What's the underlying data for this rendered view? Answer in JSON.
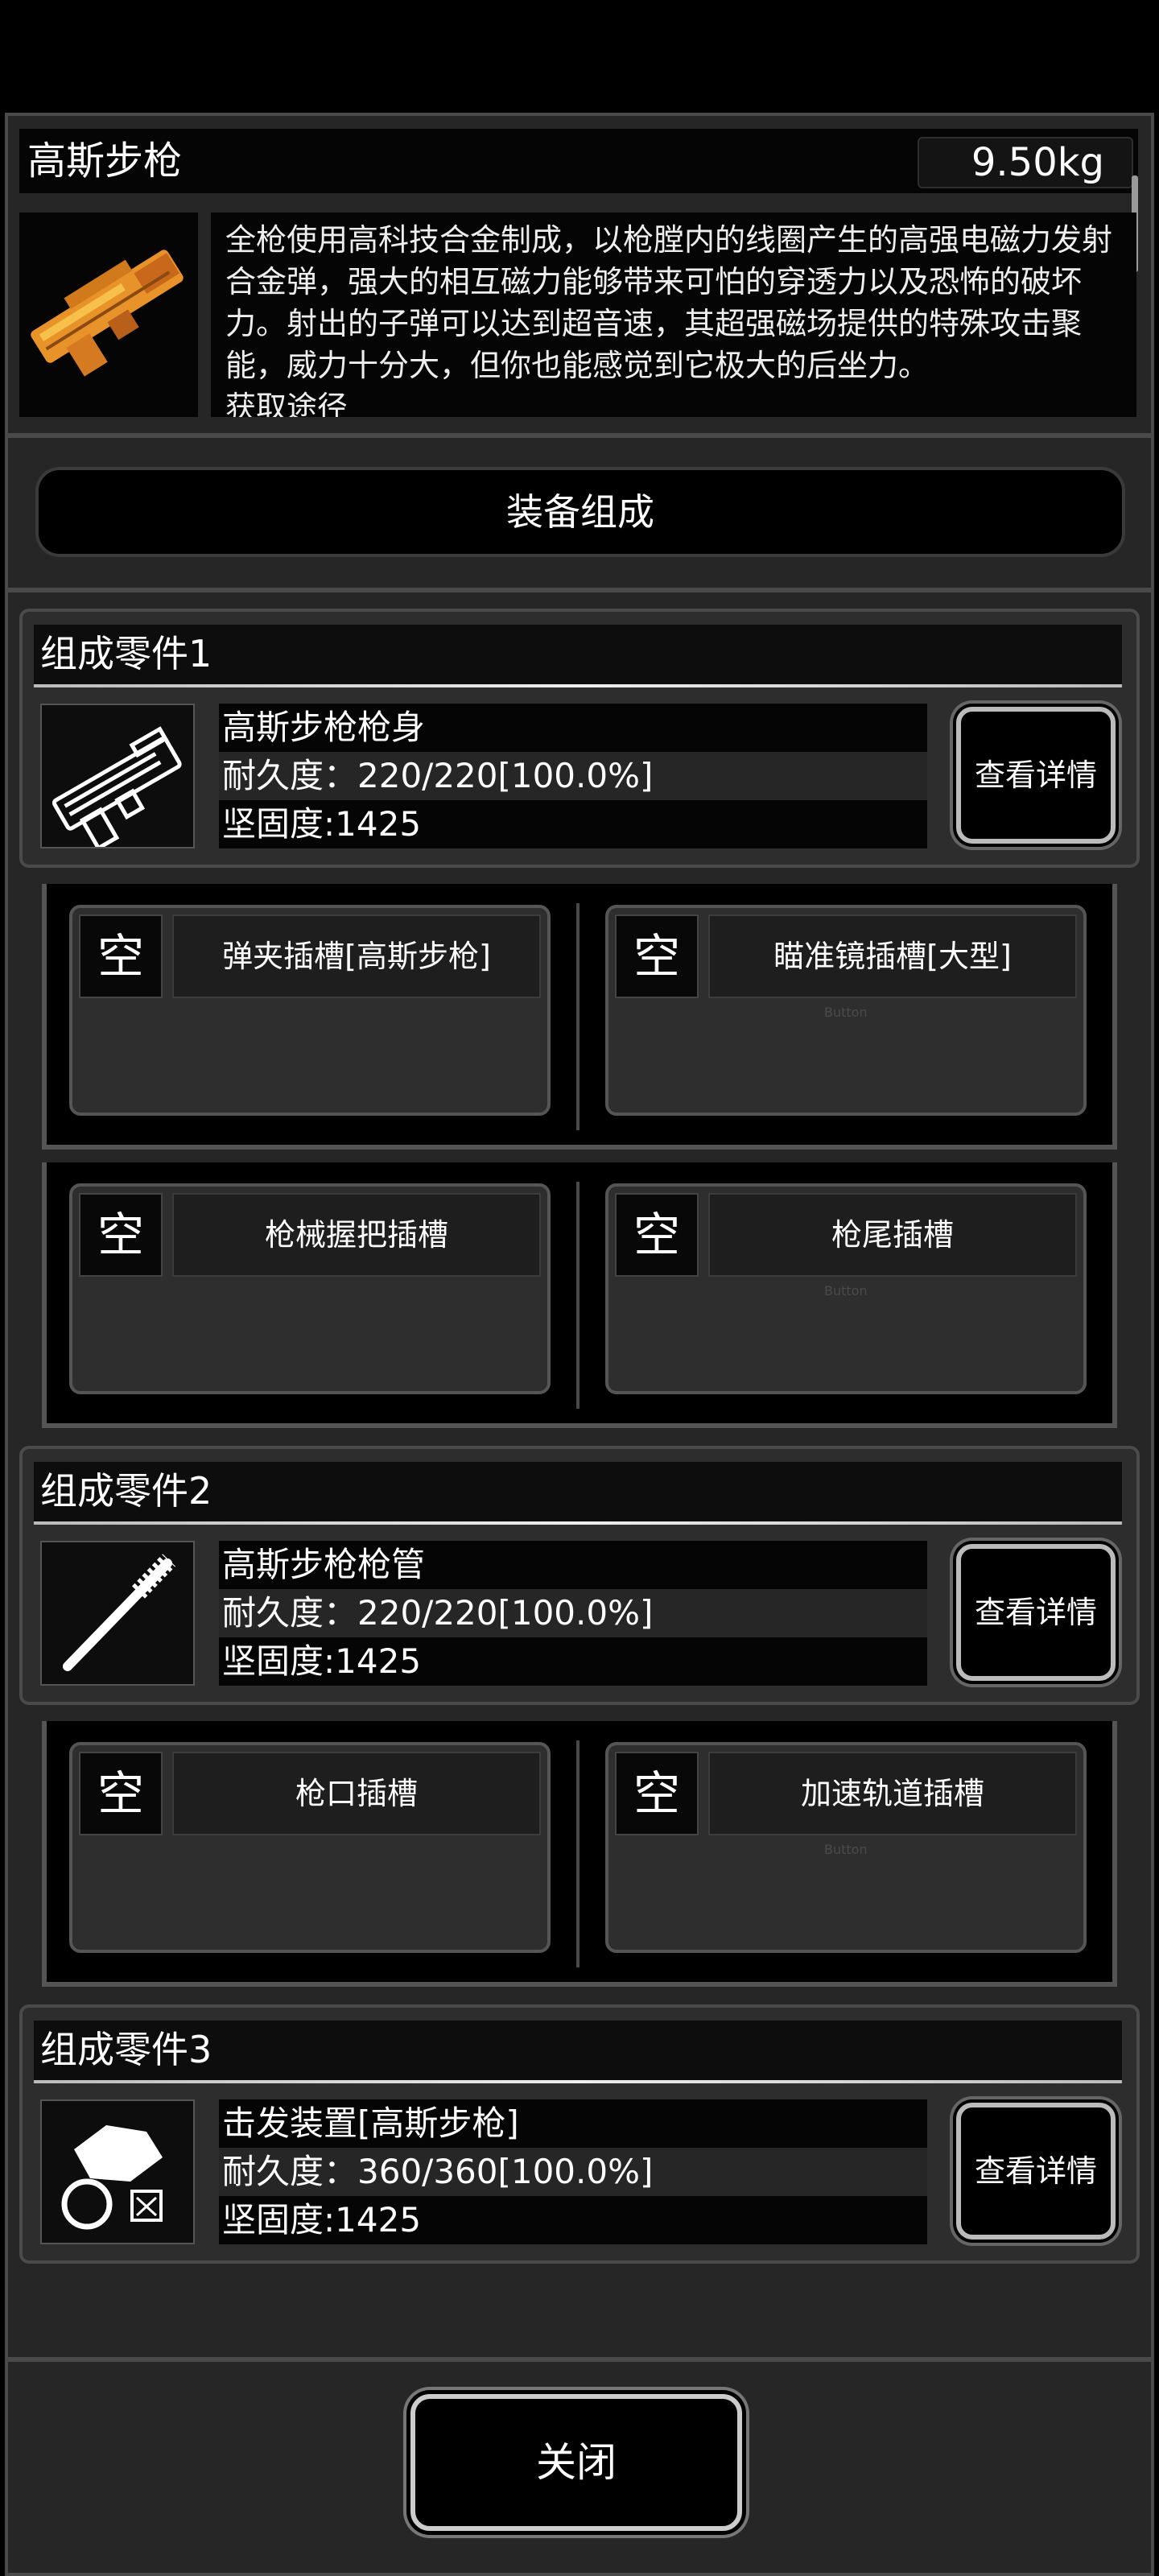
{
  "header": {
    "title": "高斯步枪",
    "weight": "9.50kg",
    "description": "全枪使用高科技合金制成，以枪膛内的线圈产生的高强电磁力发射合金弹，强大的相互磁力能够带来可怕的穿透力以及恐怖的破坏力。射出的子弹可以达到超音速，其超强磁场提供的特殊攻击聚能，威力十分大，但你也能感觉到它极大的后坐力。",
    "description_cut": "获取途径"
  },
  "compose_label": "装备组成",
  "parts": [
    {
      "title": "组成零件1",
      "name": "高斯步枪枪身",
      "durability": "耐久度：220/220[100.0%]",
      "hardness": "坚固度:1425",
      "detail_label": "查看详情",
      "slots": [
        [
          {
            "empty": "空",
            "name": "弹夹插槽[高斯步枪]",
            "ghost": ""
          },
          {
            "empty": "空",
            "name": "瞄准镜插槽[大型]",
            "ghost": "Button"
          }
        ],
        [
          {
            "empty": "空",
            "name": "枪械握把插槽",
            "ghost": ""
          },
          {
            "empty": "空",
            "name": "枪尾插槽",
            "ghost": "Button"
          }
        ]
      ]
    },
    {
      "title": "组成零件2",
      "name": "高斯步枪枪管",
      "durability": "耐久度：220/220[100.0%]",
      "hardness": "坚固度:1425",
      "detail_label": "查看详情",
      "slots": [
        [
          {
            "empty": "空",
            "name": "枪口插槽",
            "ghost": ""
          },
          {
            "empty": "空",
            "name": "加速轨道插槽",
            "ghost": "Button"
          }
        ]
      ]
    },
    {
      "title": "组成零件3",
      "name": "击发装置[高斯步枪]",
      "durability": "耐久度：360/360[100.0%]",
      "hardness": "坚固度:1425",
      "detail_label": "查看详情",
      "slots": []
    }
  ],
  "close_label": "关闭",
  "colors": {
    "panel": "#262626",
    "border": "#4a4a4a",
    "weapon_orange": "#e8922a"
  },
  "icons": [
    "gauss-rifle-icon",
    "gun-body-icon",
    "barrel-icon",
    "firing-mechanism-icon"
  ]
}
